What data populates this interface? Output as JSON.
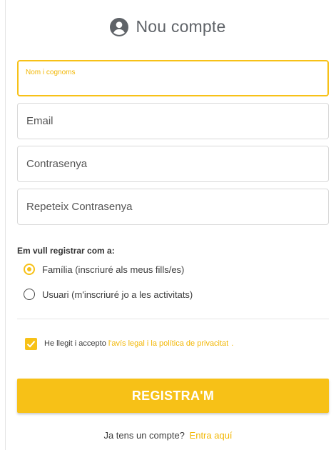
{
  "header": {
    "icon": "account-circle-icon",
    "title": "Nou compte"
  },
  "form": {
    "name": {
      "label": "Nom i cognoms",
      "value": ""
    },
    "email": {
      "placeholder": "Email",
      "value": ""
    },
    "password": {
      "placeholder": "Contrasenya",
      "value": ""
    },
    "password_repeat": {
      "placeholder": "Repeteix Contrasenya",
      "value": ""
    }
  },
  "registration_type": {
    "label": "Em vull registrar com a:",
    "options": [
      {
        "label": "Família (inscriuré als meus fills/es)",
        "selected": true
      },
      {
        "label": "Usuari (m'inscriuré jo a les activitats)",
        "selected": false
      }
    ]
  },
  "consent": {
    "checked": true,
    "text": "He llegit i accepto",
    "link_text": "l'avís legal i la política de privacitat",
    "suffix": "."
  },
  "register_button": {
    "label": "REGISTRA'M"
  },
  "footer": {
    "text": "Ja tens un compte?",
    "link_text": "Entra aquí"
  },
  "colors": {
    "accent": "#f7c117",
    "text": "#3c3c3c",
    "border": "#d9d9d9"
  }
}
